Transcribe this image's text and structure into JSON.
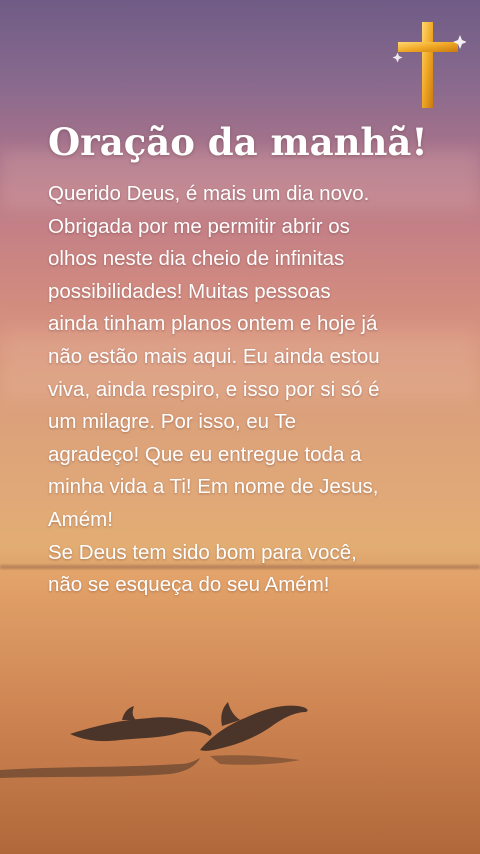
{
  "title": "Oração da manhã!",
  "body_lines": [
    "Querido Deus, é mais um dia novo.",
    "Obrigada por me permitir abrir os",
    "olhos neste dia cheio de infinitas",
    "possibilidades! Muitas pessoas",
    "ainda tinham planos ontem e hoje já",
    "não estão mais aqui. Eu ainda estou",
    "viva, ainda respiro, e isso por si só é",
    "um milagre. Por isso, eu Te",
    "agradeço! Que eu entregue toda a",
    "minha vida a Ti! Em nome de Jesus,",
    "Amém!",
    "Se Deus tem sido bom para você,",
    "não se esqueça do seu Amém!"
  ],
  "icons": [
    "golden-cross-icon",
    "dolphins-silhouette"
  ],
  "colors": {
    "text": "#ffffff",
    "cross": "#f0a825",
    "sky_top": "#6f5c86",
    "sea": "#d79561"
  }
}
